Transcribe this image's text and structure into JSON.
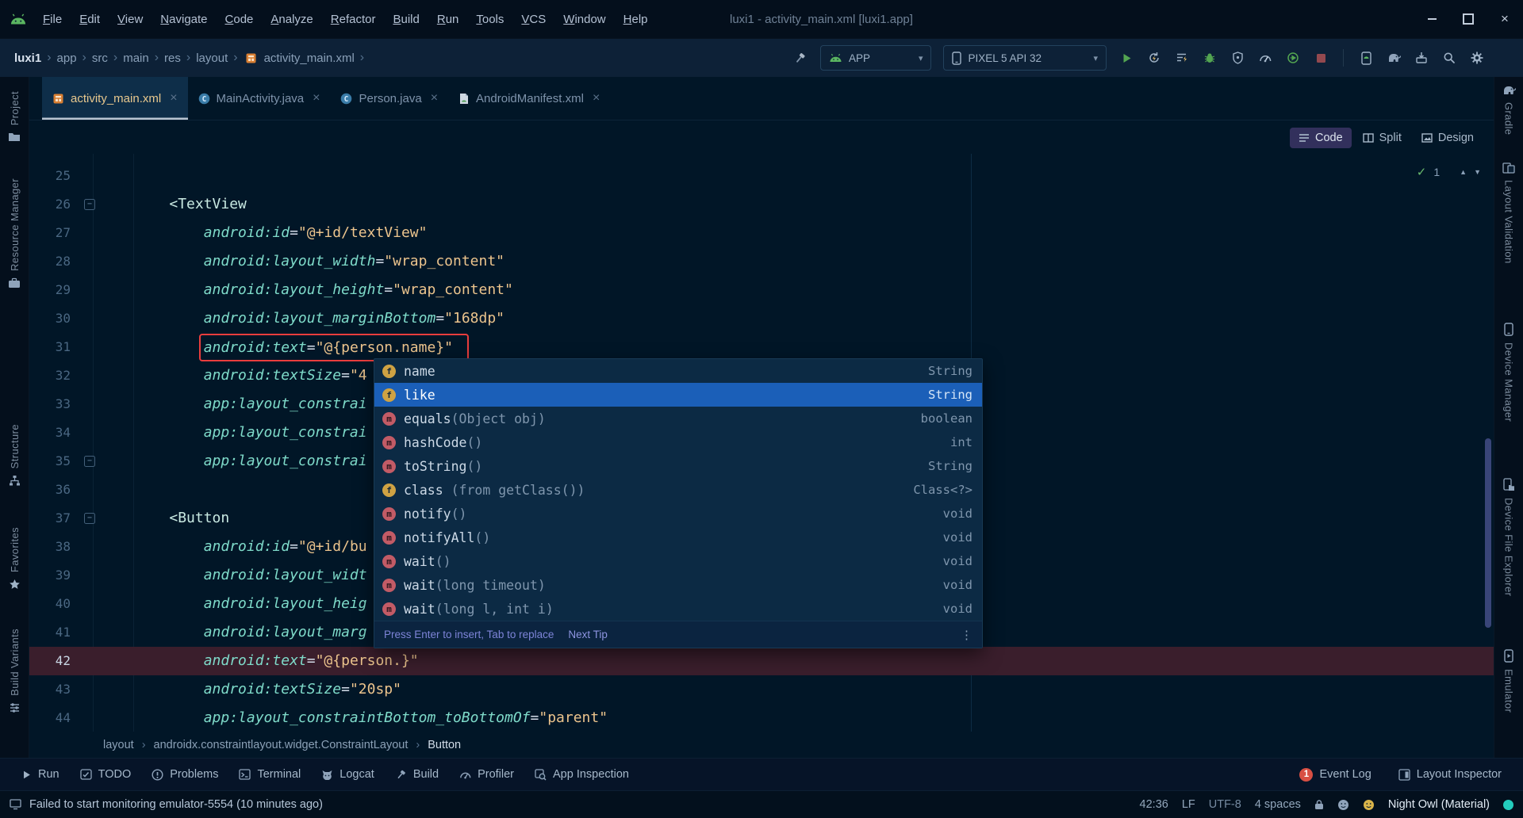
{
  "colors": {
    "background": "#011627",
    "accent_selection": "#1b5fb8",
    "error_red": "#ea3d3d",
    "success_green": "#69b96e",
    "string_orange": "#ecc48d",
    "attribute_teal": "#7fdbca",
    "current_line": "#3a1e2c",
    "run_green": "#53a551"
  },
  "window": {
    "title": "luxi1 - activity_main.xml [luxi1.app]",
    "menus": [
      "File",
      "Edit",
      "View",
      "Navigate",
      "Code",
      "Analyze",
      "Refactor",
      "Build",
      "Run",
      "Tools",
      "VCS",
      "Window",
      "Help"
    ]
  },
  "toolbar": {
    "path": [
      "luxi1",
      "app",
      "src",
      "main",
      "res",
      "layout",
      "activity_main.xml"
    ],
    "run_config": "APP",
    "device": "PIXEL 5 API 32"
  },
  "tabs": [
    {
      "label": "activity_main.xml",
      "icon": "layout-file",
      "active": true
    },
    {
      "label": "MainActivity.java",
      "icon": "class-file",
      "active": false
    },
    {
      "label": "Person.java",
      "icon": "class-file",
      "active": false
    },
    {
      "label": "AndroidManifest.xml",
      "icon": "manifest-file",
      "active": false
    }
  ],
  "stripes": {
    "left": [
      {
        "label": "Project",
        "icon": "folder"
      },
      {
        "label": "Resource Manager",
        "icon": "toolbox"
      },
      {
        "label": "Structure",
        "icon": "structure"
      },
      {
        "label": "Favorites",
        "icon": "star"
      },
      {
        "label": "Build Variants",
        "icon": "variants"
      }
    ],
    "right": [
      {
        "label": "Gradle",
        "icon": "gradle"
      },
      {
        "label": "Layout Validation",
        "icon": "layout-validation"
      },
      {
        "label": "Device Manager",
        "icon": "device"
      },
      {
        "label": "Device File Explorer",
        "icon": "device-explorer"
      },
      {
        "label": "Emulator",
        "icon": "emulator"
      }
    ]
  },
  "editor": {
    "current_line": 42,
    "inspections": {
      "count": "1"
    },
    "modes": [
      {
        "label": "Code",
        "icon": "code-mode",
        "active": true
      },
      {
        "label": "Split",
        "icon": "split-mode",
        "active": false
      },
      {
        "label": "Design",
        "icon": "design-mode",
        "active": false
      }
    ],
    "lines": [
      {
        "n": 25,
        "tokens": []
      },
      {
        "n": 26,
        "fold": "start",
        "tokens": [
          [
            "sp",
            "    "
          ],
          [
            "tag",
            "<TextView"
          ]
        ]
      },
      {
        "n": 27,
        "tokens": [
          [
            "sp",
            "        "
          ],
          [
            "attr",
            "android:id"
          ],
          [
            "eq",
            "="
          ],
          [
            "val",
            "\"@+id/textView\""
          ]
        ]
      },
      {
        "n": 28,
        "tokens": [
          [
            "sp",
            "        "
          ],
          [
            "attr",
            "android:layout_width"
          ],
          [
            "eq",
            "="
          ],
          [
            "val",
            "\"wrap_content\""
          ]
        ]
      },
      {
        "n": 29,
        "tokens": [
          [
            "sp",
            "        "
          ],
          [
            "attr",
            "android:layout_height"
          ],
          [
            "eq",
            "="
          ],
          [
            "val",
            "\"wrap_content\""
          ]
        ]
      },
      {
        "n": 30,
        "tokens": [
          [
            "sp",
            "        "
          ],
          [
            "attr",
            "android:layout_marginBottom"
          ],
          [
            "eq",
            "="
          ],
          [
            "val",
            "\"168dp\""
          ]
        ]
      },
      {
        "n": 31,
        "boxed": true,
        "tokens": [
          [
            "sp",
            "        "
          ],
          [
            "attr",
            "android:text"
          ],
          [
            "eq",
            "="
          ],
          [
            "val",
            "\"@{person.name}\""
          ]
        ]
      },
      {
        "n": 32,
        "tokens": [
          [
            "sp",
            "        "
          ],
          [
            "attr",
            "android:textSize"
          ],
          [
            "eq",
            "="
          ],
          [
            "val",
            "\"4"
          ]
        ]
      },
      {
        "n": 33,
        "tokens": [
          [
            "sp",
            "        "
          ],
          [
            "attr",
            "app:layout_constrai"
          ]
        ]
      },
      {
        "n": 34,
        "tokens": [
          [
            "sp",
            "        "
          ],
          [
            "attr",
            "app:layout_constrai"
          ]
        ]
      },
      {
        "n": 35,
        "fold": "end",
        "tokens": [
          [
            "sp",
            "        "
          ],
          [
            "attr",
            "app:layout_constrai"
          ]
        ]
      },
      {
        "n": 36,
        "tokens": []
      },
      {
        "n": 37,
        "fold": "start",
        "tokens": [
          [
            "sp",
            "    "
          ],
          [
            "tag",
            "<Button"
          ]
        ]
      },
      {
        "n": 38,
        "tokens": [
          [
            "sp",
            "        "
          ],
          [
            "attr",
            "android:id"
          ],
          [
            "eq",
            "="
          ],
          [
            "val",
            "\"@+id/bu"
          ]
        ]
      },
      {
        "n": 39,
        "tokens": [
          [
            "sp",
            "        "
          ],
          [
            "attr",
            "android:layout_widt"
          ]
        ]
      },
      {
        "n": 40,
        "tokens": [
          [
            "sp",
            "        "
          ],
          [
            "attr",
            "android:layout_heig"
          ]
        ]
      },
      {
        "n": 41,
        "tokens": [
          [
            "sp",
            "        "
          ],
          [
            "attr",
            "android:layout_marg"
          ]
        ]
      },
      {
        "n": 42,
        "tokens": [
          [
            "sp",
            "        "
          ],
          [
            "attr",
            "android:text"
          ],
          [
            "eq",
            "="
          ],
          [
            "val",
            "\"@{person.}\""
          ]
        ]
      },
      {
        "n": 43,
        "tokens": [
          [
            "sp",
            "        "
          ],
          [
            "attr",
            "android:textSize"
          ],
          [
            "eq",
            "="
          ],
          [
            "val",
            "\"20sp\""
          ]
        ]
      },
      {
        "n": 44,
        "tokens": [
          [
            "sp",
            "        "
          ],
          [
            "attr",
            "app:layout_constraintBottom_toBottomOf"
          ],
          [
            "eq",
            "="
          ],
          [
            "val",
            "\"parent\""
          ]
        ]
      }
    ]
  },
  "popup": {
    "items": [
      {
        "icon": "field",
        "label": "name",
        "detail": "",
        "type": "String"
      },
      {
        "icon": "field",
        "label": "like",
        "detail": "",
        "type": "String",
        "selected": true
      },
      {
        "icon": "method",
        "label": "equals",
        "detail": "(Object obj)",
        "type": "boolean"
      },
      {
        "icon": "method",
        "label": "hashCode",
        "detail": "()",
        "type": "int"
      },
      {
        "icon": "method",
        "label": "toString",
        "detail": "()",
        "type": "String"
      },
      {
        "icon": "field",
        "label": "class",
        "detail": " (from getClass())",
        "type": "Class<?>"
      },
      {
        "icon": "method",
        "label": "notify",
        "detail": "()",
        "type": "void"
      },
      {
        "icon": "method",
        "label": "notifyAll",
        "detail": "()",
        "type": "void"
      },
      {
        "icon": "method",
        "label": "wait",
        "detail": "()",
        "type": "void"
      },
      {
        "icon": "method",
        "label": "wait",
        "detail": "(long timeout)",
        "type": "void"
      },
      {
        "icon": "method",
        "label": "wait",
        "detail": "(long l, int i)",
        "type": "void"
      }
    ],
    "footer": {
      "hint": "Press Enter to insert, Tab to replace",
      "tip": "Next Tip"
    }
  },
  "breadcrumbs": [
    "layout",
    "androidx.constraintlayout.widget.ConstraintLayout",
    "Button"
  ],
  "bottom_bar": {
    "left": [
      {
        "label": "Run",
        "icon": "play-gray"
      },
      {
        "label": "TODO",
        "icon": "todo"
      },
      {
        "label": "Problems",
        "icon": "problems"
      },
      {
        "label": "Terminal",
        "icon": "terminal"
      },
      {
        "label": "Logcat",
        "icon": "logcat"
      },
      {
        "label": "Build",
        "icon": "build"
      },
      {
        "label": "Profiler",
        "icon": "profiler"
      },
      {
        "label": "App Inspection",
        "icon": "inspection"
      }
    ],
    "right": [
      {
        "label": "Event Log",
        "badge": "1"
      },
      {
        "label": "Layout Inspector",
        "icon": "layout-inspector"
      }
    ]
  },
  "status": {
    "message": "Failed to start monitoring emulator-5554 (10 minutes ago)",
    "caret": "42:36",
    "line_ending": "LF",
    "encoding": "UTF-8",
    "indent": "4 spaces",
    "theme": "Night Owl (Material)"
  }
}
